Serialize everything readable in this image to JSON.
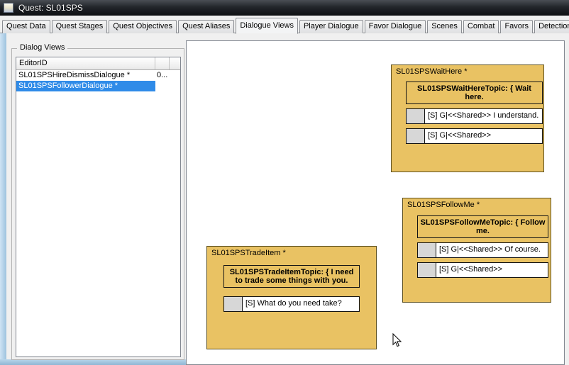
{
  "window": {
    "title": "Quest: SL01SPS"
  },
  "tabs": [
    {
      "label": "Quest Data",
      "active": false
    },
    {
      "label": "Quest Stages",
      "active": false
    },
    {
      "label": "Quest Objectives",
      "active": false
    },
    {
      "label": "Quest Aliases",
      "active": false
    },
    {
      "label": "Dialogue Views",
      "active": true
    },
    {
      "label": "Player Dialogue",
      "active": false
    },
    {
      "label": "Favor Dialogue",
      "active": false
    },
    {
      "label": "Scenes",
      "active": false
    },
    {
      "label": "Combat",
      "active": false
    },
    {
      "label": "Favors",
      "active": false
    },
    {
      "label": "Detection",
      "active": false
    }
  ],
  "dialog_views_panel": {
    "group_label": "Dialog Views",
    "columns": {
      "editor_id": "EditorID"
    },
    "rows": [
      {
        "editor_id": "SL01SPSHireDismissDialogue *",
        "extra": "0...",
        "selected": false
      },
      {
        "editor_id": "SL01SPSFollowerDialogue *",
        "extra": "",
        "selected": true
      }
    ]
  },
  "canvas": {
    "views": [
      {
        "name": "SL01SPSWaitHere *",
        "topic": "SL01SPSWaitHereTopic: { Wait here.",
        "responses": [
          "[S] G|<<Shared>> I understand.",
          "[S] G|<<Shared>>"
        ]
      },
      {
        "name": "SL01SPSFollowMe *",
        "topic": "SL01SPSFollowMeTopic: { Follow me.",
        "responses": [
          "[S] G|<<Shared>> Of course.",
          "[S] G|<<Shared>>"
        ]
      },
      {
        "name": "SL01SPSTradeItem *",
        "topic": "SL01SPSTradeItemTopic: { I need to trade some things with you.",
        "responses": [
          "[S] What do you need take?"
        ]
      }
    ]
  },
  "colors": {
    "view_box_fill": "#e9c263",
    "selection_blue": "#2f8be8",
    "canvas_bg": "#ffffff",
    "titlebar_dark": "#16181b"
  }
}
